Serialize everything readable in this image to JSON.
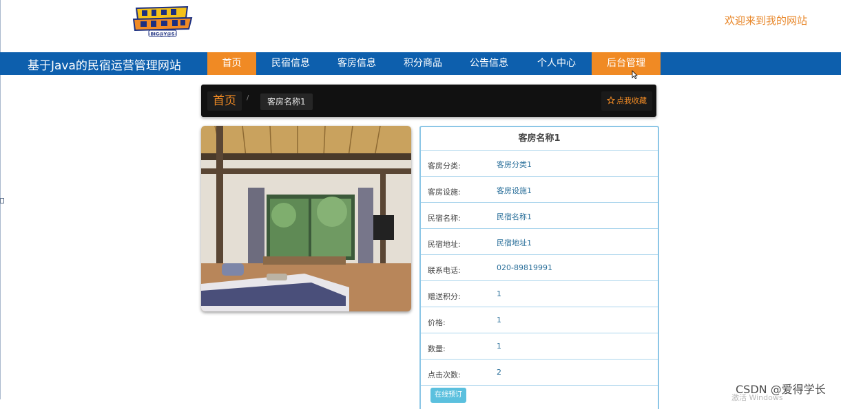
{
  "header": {
    "welcome": "欢迎来到我的网站",
    "logo_text_top": "デジモン",
    "logo_text_bottom": "-BIG@Y@S-"
  },
  "navbar": {
    "site_title": "基于Java的民宿运营管理网站",
    "items": [
      {
        "label": "首页"
      },
      {
        "label": "民宿信息"
      },
      {
        "label": "客房信息"
      },
      {
        "label": "积分商品"
      },
      {
        "label": "公告信息"
      },
      {
        "label": "个人中心"
      },
      {
        "label": "后台管理"
      }
    ]
  },
  "breadcrumb": {
    "home": "首页",
    "separator": "/",
    "current": "客房名称1",
    "favorite": "点我收藏"
  },
  "detail": {
    "title": "客房名称1",
    "rows": [
      {
        "label": "客房分类:",
        "value": "客房分类1"
      },
      {
        "label": "客房设施:",
        "value": "客房设施1"
      },
      {
        "label": "民宿名称:",
        "value": "民宿名称1"
      },
      {
        "label": "民宿地址:",
        "value": "民宿地址1"
      },
      {
        "label": "联系电话:",
        "value": "020-89819991"
      },
      {
        "label": "赠送积分:",
        "value": "1"
      },
      {
        "label": "价格:",
        "value": "1"
      },
      {
        "label": "数量:",
        "value": "1"
      },
      {
        "label": "点击次数:",
        "value": "2"
      }
    ],
    "book_button": "在线预订"
  },
  "watermark": {
    "csdn": "CSDN @爱得学长",
    "activate": "激活 Windows"
  },
  "colors": {
    "nav_bg": "#0d5fad",
    "accent": "#f08a24",
    "panel_border": "#8cc6e6"
  }
}
